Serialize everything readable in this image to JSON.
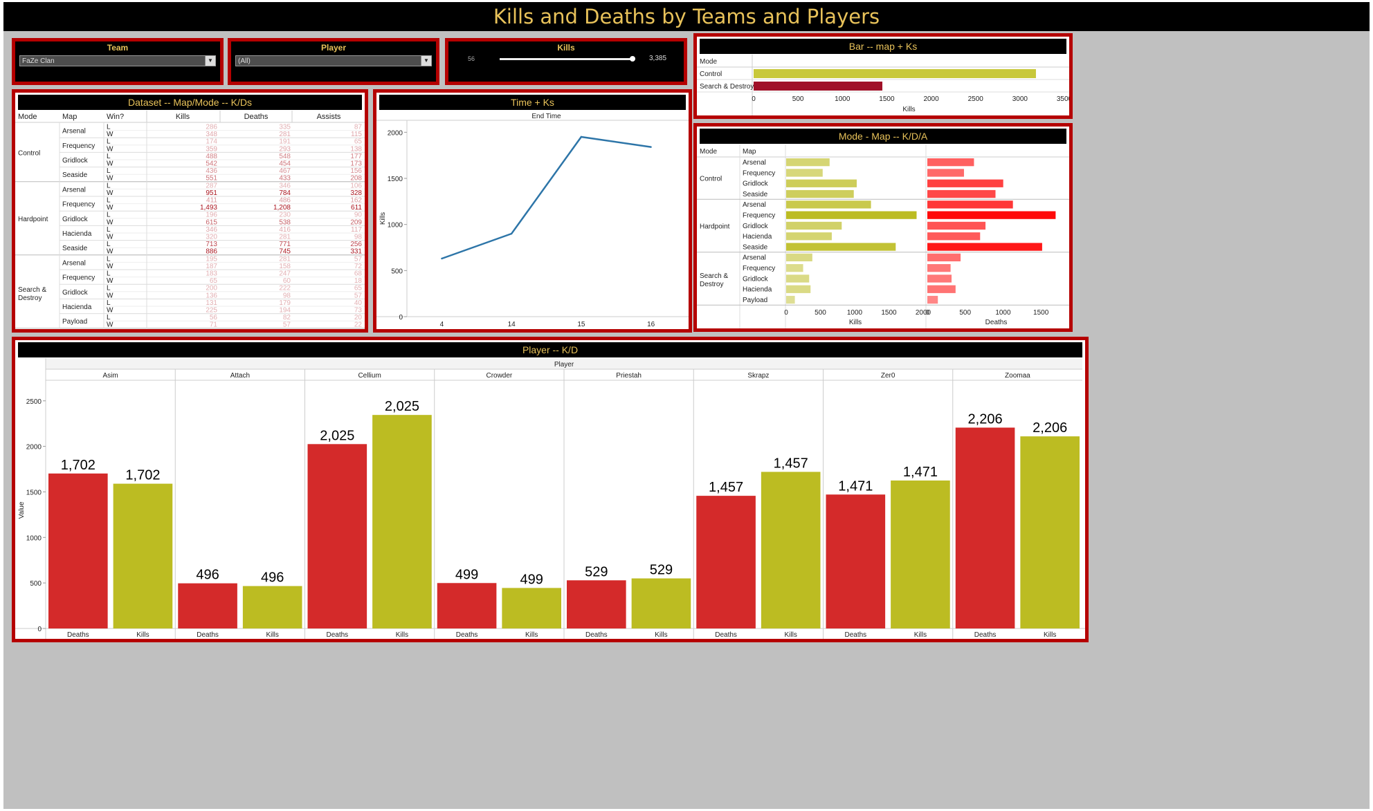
{
  "title": "Kills and Deaths by Teams and Players",
  "colors": {
    "accent": "#e8c25a",
    "border": "#b50000",
    "deaths": "#d42a2a",
    "kills": "#bcbc22",
    "line": "#2d75a8",
    "control": "#c8c83a",
    "sd": "#a01028"
  },
  "filters": {
    "team": {
      "label": "Team",
      "value": "FaZe Clan"
    },
    "player": {
      "label": "Player",
      "value": "(All)"
    },
    "kills": {
      "label": "Kills",
      "min": "56",
      "max": "3,385",
      "slider_fraction": 1.0
    }
  },
  "dataset_table": {
    "title": "Dataset -- Map/Mode -- K/Ds",
    "headers": [
      "Mode",
      "Map",
      "Win?",
      "Kills",
      "Deaths",
      "Assists"
    ],
    "groups": [
      {
        "mode": "Control",
        "maps": [
          {
            "map": "Arsenal",
            "rows": [
              [
                "L",
                "286",
                "335",
                "87"
              ],
              [
                "W",
                "348",
                "281",
                "115"
              ]
            ]
          },
          {
            "map": "Frequency",
            "rows": [
              [
                "L",
                "174",
                "191",
                "65"
              ],
              [
                "W",
                "359",
                "293",
                "138"
              ]
            ]
          },
          {
            "map": "Gridlock",
            "rows": [
              [
                "L",
                "488",
                "548",
                "177"
              ],
              [
                "W",
                "542",
                "454",
                "173"
              ]
            ]
          },
          {
            "map": "Seaside",
            "rows": [
              [
                "L",
                "436",
                "467",
                "156"
              ],
              [
                "W",
                "551",
                "433",
                "208"
              ]
            ]
          }
        ]
      },
      {
        "mode": "Hardpoint",
        "maps": [
          {
            "map": "Arsenal",
            "rows": [
              [
                "L",
                "287",
                "346",
                "106"
              ],
              [
                "W",
                "951",
                "784",
                "328"
              ]
            ]
          },
          {
            "map": "Frequency",
            "rows": [
              [
                "L",
                "411",
                "486",
                "162"
              ],
              [
                "W",
                "1,493",
                "1,208",
                "611"
              ]
            ]
          },
          {
            "map": "Gridlock",
            "rows": [
              [
                "L",
                "196",
                "230",
                "90"
              ],
              [
                "W",
                "615",
                "538",
                "209"
              ]
            ]
          },
          {
            "map": "Hacienda",
            "rows": [
              [
                "L",
                "346",
                "416",
                "117"
              ],
              [
                "W",
                "320",
                "281",
                "98"
              ]
            ]
          },
          {
            "map": "Seaside",
            "rows": [
              [
                "L",
                "713",
                "771",
                "256"
              ],
              [
                "W",
                "886",
                "745",
                "331"
              ]
            ]
          }
        ]
      },
      {
        "mode": "Search & Destroy",
        "maps": [
          {
            "map": "Arsenal",
            "rows": [
              [
                "L",
                "195",
                "281",
                "57"
              ],
              [
                "W",
                "187",
                "158",
                "72"
              ]
            ]
          },
          {
            "map": "Frequency",
            "rows": [
              [
                "L",
                "183",
                "247",
                "68"
              ],
              [
                "W",
                "65",
                "60",
                "18"
              ]
            ]
          },
          {
            "map": "Gridlock",
            "rows": [
              [
                "L",
                "200",
                "222",
                "65"
              ],
              [
                "W",
                "136",
                "98",
                "57"
              ]
            ]
          },
          {
            "map": "Hacienda",
            "rows": [
              [
                "L",
                "131",
                "179",
                "40"
              ],
              [
                "W",
                "225",
                "194",
                "73"
              ]
            ]
          },
          {
            "map": "Payload",
            "rows": [
              [
                "L",
                "56",
                "82",
                "20"
              ],
              [
                "W",
                "71",
                "57",
                "22"
              ]
            ]
          }
        ]
      }
    ]
  },
  "chart_data": [
    {
      "id": "time_ks",
      "type": "line",
      "title": "Time + Ks",
      "xlabel": "End Time",
      "ylabel": "Kills",
      "categories": [
        "4",
        "14",
        "15",
        "16"
      ],
      "values": [
        630,
        900,
        1950,
        1840
      ],
      "yticks": [
        "0",
        "500",
        "1000",
        "1500",
        "2000"
      ],
      "ylim": [
        0,
        2100
      ]
    },
    {
      "id": "bar_map_ks",
      "type": "bar",
      "title": "Bar -- map + Ks",
      "category_header": "Mode",
      "categories": [
        "Control",
        "Search & Destroy"
      ],
      "values": [
        3180,
        1450
      ],
      "xlabel": "Kills",
      "xticks": [
        "0",
        "500",
        "1000",
        "1500",
        "2000",
        "2500",
        "3000",
        "3500"
      ],
      "xlim": [
        0,
        3500
      ]
    },
    {
      "id": "mode_map_kda",
      "type": "bar",
      "title": "Mode - Map -- K/D/A",
      "headers": [
        "Mode",
        "Map"
      ],
      "modes": [
        {
          "mode": "Control",
          "maps": [
            "Arsenal",
            "Frequency",
            "Gridlock",
            "Seaside"
          ]
        },
        {
          "mode": "Hardpoint",
          "maps": [
            "Arsenal",
            "Frequency",
            "Gridlock",
            "Hacienda",
            "Seaside"
          ]
        },
        {
          "mode": "Search & Destroy",
          "maps": [
            "Arsenal",
            "Frequency",
            "Gridlock",
            "Hacienda",
            "Payload"
          ]
        }
      ],
      "series": [
        {
          "name": "Kills",
          "values": [
            634,
            533,
            1030,
            987,
            1238,
            1904,
            811,
            666,
            1599,
            382,
            248,
            336,
            356,
            127
          ],
          "xticks": [
            "0",
            "500",
            "1000",
            "1500",
            "2000"
          ],
          "xlim": [
            0,
            2000
          ]
        },
        {
          "name": "Deaths",
          "values": [
            616,
            484,
            1002,
            900,
            1130,
            1694,
            768,
            697,
            1516,
            439,
            307,
            320,
            373,
            139
          ],
          "xticks": [
            "0",
            "500",
            "1000",
            "1500"
          ],
          "xlim": [
            0,
            1800
          ]
        }
      ]
    },
    {
      "id": "player_kd",
      "type": "bar",
      "title": "Player -- K/D",
      "group_header": "Player",
      "ylabel": "Value",
      "players": [
        "Asim",
        "Attach",
        "Cellium",
        "Crowder",
        "Priestah",
        "Skrapz",
        "Zer0",
        "Zoomaa"
      ],
      "series": [
        {
          "name": "Deaths",
          "values": [
            1702,
            496,
            2025,
            499,
            529,
            1457,
            1471,
            2206
          ],
          "labels": [
            "1,702",
            "496",
            "2,025",
            "499",
            "529",
            "1,457",
            "1,471",
            "2,206"
          ]
        },
        {
          "name": "Kills",
          "values": [
            1590,
            466,
            2345,
            445,
            550,
            1720,
            1625,
            2110
          ],
          "labels": [
            "1,702",
            "496",
            "2,025",
            "499",
            "529",
            "1,457",
            "1,471",
            "2,206"
          ]
        }
      ],
      "yticks": [
        "0",
        "500",
        "1000",
        "1500",
        "2000",
        "2500"
      ],
      "ylim": [
        0,
        2650
      ]
    }
  ]
}
